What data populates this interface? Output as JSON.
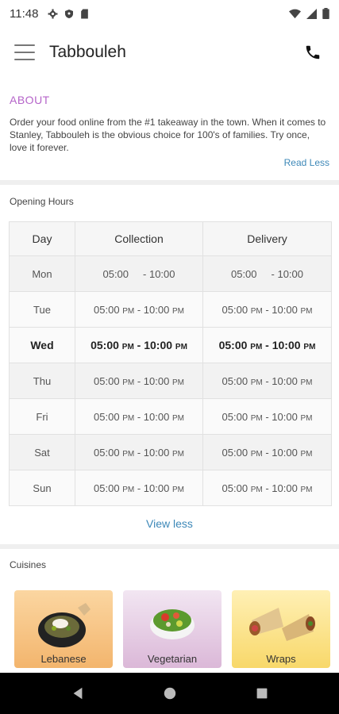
{
  "status": {
    "time": "11:48"
  },
  "appbar": {
    "title": "Tabbouleh"
  },
  "about": {
    "label": "ABOUT",
    "text": "Order your food online from the #1 takeaway in the town. When it comes to Stanley, Tabbouleh is the obvious choice for 100's of families. Try once, love it forever.",
    "read_less": "Read Less"
  },
  "hours": {
    "title": "Opening Hours",
    "headers": [
      "Day",
      "Collection",
      "Delivery"
    ],
    "rows": [
      {
        "day": "Mon",
        "collection_start": "05:00",
        "collection_end": "- 10:00",
        "delivery_start": "05:00",
        "delivery_end": "- 10:00"
      },
      {
        "day": "Tue",
        "collection_start": "05:00",
        "collection_end": "- 10:00",
        "delivery_start": "05:00",
        "delivery_end": "- 10:00"
      },
      {
        "day": "Wed",
        "collection_start": "05:00",
        "collection_end": "- 10:00",
        "delivery_start": "05:00",
        "delivery_end": "- 10:00"
      },
      {
        "day": "Thu",
        "collection_start": "05:00",
        "collection_end": "- 10:00",
        "delivery_start": "05:00",
        "delivery_end": "- 10:00"
      },
      {
        "day": "Fri",
        "collection_start": "05:00",
        "collection_end": "- 10:00",
        "delivery_start": "05:00",
        "delivery_end": "- 10:00"
      },
      {
        "day": "Sat",
        "collection_start": "05:00",
        "collection_end": "- 10:00",
        "delivery_start": "05:00",
        "delivery_end": "- 10:00"
      },
      {
        "day": "Sun",
        "collection_start": "05:00",
        "collection_end": "- 10:00",
        "delivery_start": "05:00",
        "delivery_end": "- 10:00"
      }
    ],
    "pm": "PM",
    "view_less": "View less"
  },
  "cuisines": {
    "title": "Cuisines",
    "items": [
      "Lebanese",
      "Vegetarian",
      "Wraps"
    ]
  },
  "colors": {
    "accent": "#b564c9",
    "link": "#3d88b8"
  }
}
